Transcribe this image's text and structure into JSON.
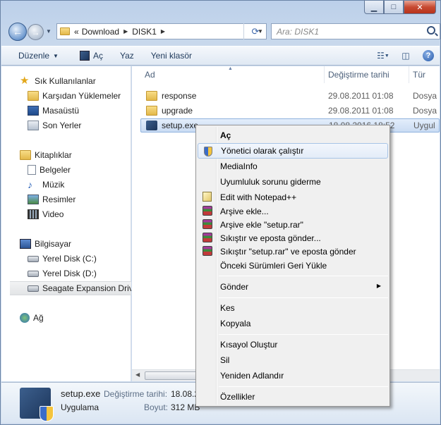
{
  "window": {
    "close_glyph": "✕",
    "min_glyph": "▁",
    "max_glyph": "□"
  },
  "address": {
    "prefix": "«",
    "segments": [
      "Download",
      "DISK1"
    ],
    "search_placeholder": "Ara: DISK1"
  },
  "toolbar": {
    "organize": "Düzenle",
    "open": "Aç",
    "print": "Yaz",
    "new_folder": "Yeni klasör"
  },
  "sidebar": {
    "favorites_header": "Sık Kullanılanlar",
    "favorites": [
      "Karşıdan Yüklemeler",
      "Masaüstü",
      "Son Yerler"
    ],
    "libraries_header": "Kitaplıklar",
    "libraries": [
      "Belgeler",
      "Müzik",
      "Resimler",
      "Video"
    ],
    "computer_header": "Bilgisayar",
    "drives": [
      "Yerel Disk (C:)",
      "Yerel Disk (D:)",
      "Seagate Expansion Drive"
    ],
    "network": "Ağ"
  },
  "columns": {
    "name": "Ad",
    "date": "Değiştirme tarihi",
    "type": "Tür"
  },
  "files": [
    {
      "name": "response",
      "date": "29.08.2011 01:08",
      "type": "Dosya"
    },
    {
      "name": "upgrade",
      "date": "29.08.2011 01:08",
      "type": "Dosya"
    },
    {
      "name": "setup.exe",
      "date": "18.08.2016 18:52",
      "type": "Uygul"
    }
  ],
  "details": {
    "filename": "setup.exe",
    "modified_label": "Değiştirme tarihi:",
    "modified_value": "18.08.2016 18:53",
    "type": "Uygulama",
    "size_label": "Boyut:",
    "size_value": "312 MB"
  },
  "context_menu": {
    "open": "Aç",
    "run_as_admin": "Yönetici olarak çalıştır",
    "mediainfo": "MediaInfo",
    "troubleshoot": "Uyumluluk sorunu giderme",
    "notepadpp": "Edit with Notepad++",
    "add_archive": "Arşive ekle...",
    "add_archive_named": "Arşive ekle \"setup.rar\"",
    "compress_email": "Sıkıştır ve eposta gönder...",
    "compress_named_email": "Sıkıştır \"setup.rar\" ve eposta gönder",
    "restore_prev": "Önceki Sürümleri Geri Yükle",
    "send_to": "Gönder",
    "cut": "Kes",
    "copy": "Kopyala",
    "create_shortcut": "Kısayol Oluştur",
    "delete": "Sil",
    "rename": "Yeniden Adlandır",
    "properties": "Özellikler"
  }
}
